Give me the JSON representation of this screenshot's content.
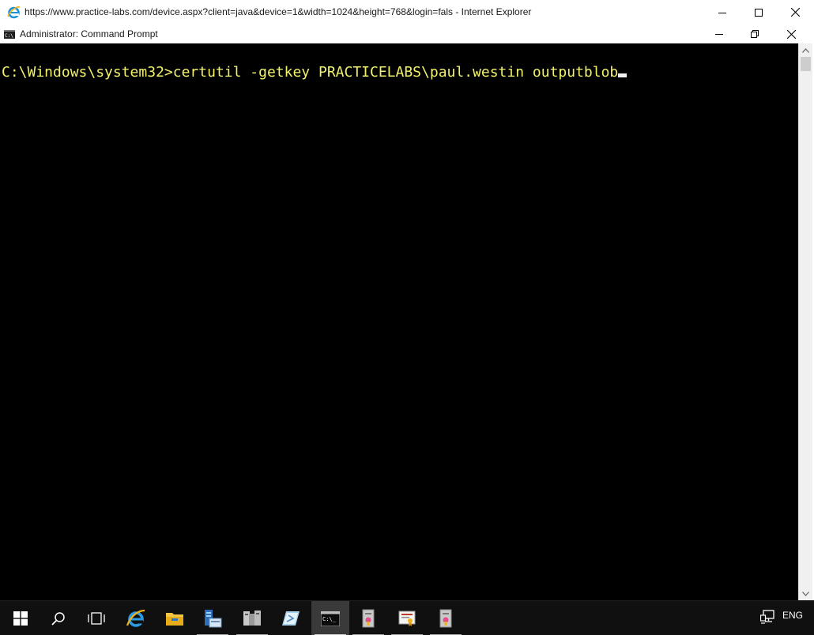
{
  "browser": {
    "title": "https://www.practice-labs.com/device.aspx?client=java&device=1&width=1024&height=768&login=fals - Internet Explorer",
    "icon": "internet-explorer-icon"
  },
  "cmd_window": {
    "title": "Administrator: Command Prompt",
    "icon": "command-prompt-icon"
  },
  "console": {
    "prompt": "C:\\Windows\\system32>",
    "command": "certutil -getkey PRACTICELABS\\paul.westin outputblob",
    "text_color": "#f2f26c",
    "background_color": "#000000"
  },
  "taskbar": {
    "items": [
      {
        "name": "start-icon",
        "running": false
      },
      {
        "name": "search-icon",
        "running": false
      },
      {
        "name": "task-view-icon",
        "running": false
      },
      {
        "name": "internet-explorer-icon",
        "running": false
      },
      {
        "name": "file-explorer-icon",
        "running": false
      },
      {
        "name": "server-manager-icon",
        "running": true
      },
      {
        "name": "administrative-tools-icon",
        "running": true
      },
      {
        "name": "powershell-ise-icon",
        "running": false
      },
      {
        "name": "command-prompt-icon",
        "running": true,
        "active": true
      },
      {
        "name": "certificate-store-icon",
        "running": true
      },
      {
        "name": "certification-authority-icon",
        "running": true
      },
      {
        "name": "certificate-templates-icon",
        "running": true
      }
    ],
    "tray": {
      "network_icon": "network-icon",
      "language": "ENG"
    }
  }
}
